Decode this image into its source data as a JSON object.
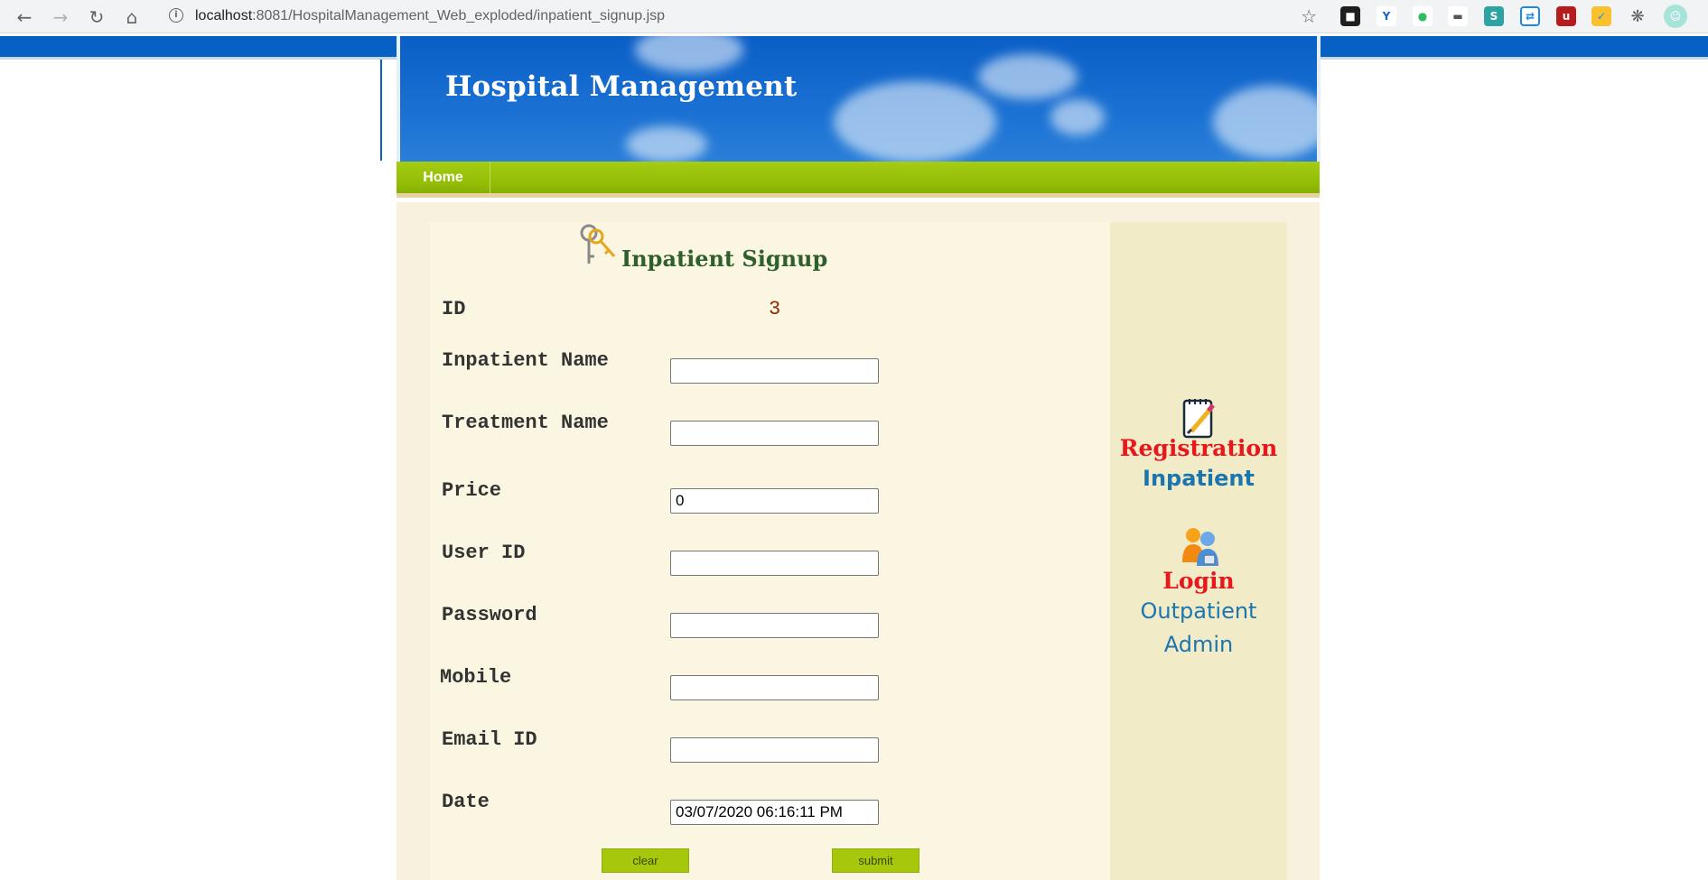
{
  "browser": {
    "url_host": "localhost",
    "url_path": ":8081/HospitalManagement_Web_exploded/inpatient_signup.jsp"
  },
  "site": {
    "title": "Hospital Management"
  },
  "menu": {
    "home": "Home"
  },
  "form": {
    "title": "Inpatient Signup",
    "id_label": "ID",
    "id_value": "3",
    "fields": {
      "inpatient_name": {
        "label": "Inpatient Name",
        "value": ""
      },
      "treatment_name": {
        "label": "Treatment Name",
        "value": ""
      },
      "price": {
        "label": "Price",
        "value": "0"
      },
      "user_id": {
        "label": "User ID",
        "value": ""
      },
      "password": {
        "label": "Password",
        "value": ""
      },
      "mobile": {
        "label": "Mobile",
        "value": ""
      },
      "email_id": {
        "label": "Email ID",
        "value": ""
      },
      "date": {
        "label": "Date",
        "value": "03/07/2020 06:16:11 PM"
      }
    },
    "clear_label": "clear",
    "submit_label": "submit"
  },
  "sidebar": {
    "registration": "Registration",
    "inpatient": "Inpatient",
    "login": "Login",
    "outpatient": "Outpatient",
    "admin": "Admin"
  }
}
